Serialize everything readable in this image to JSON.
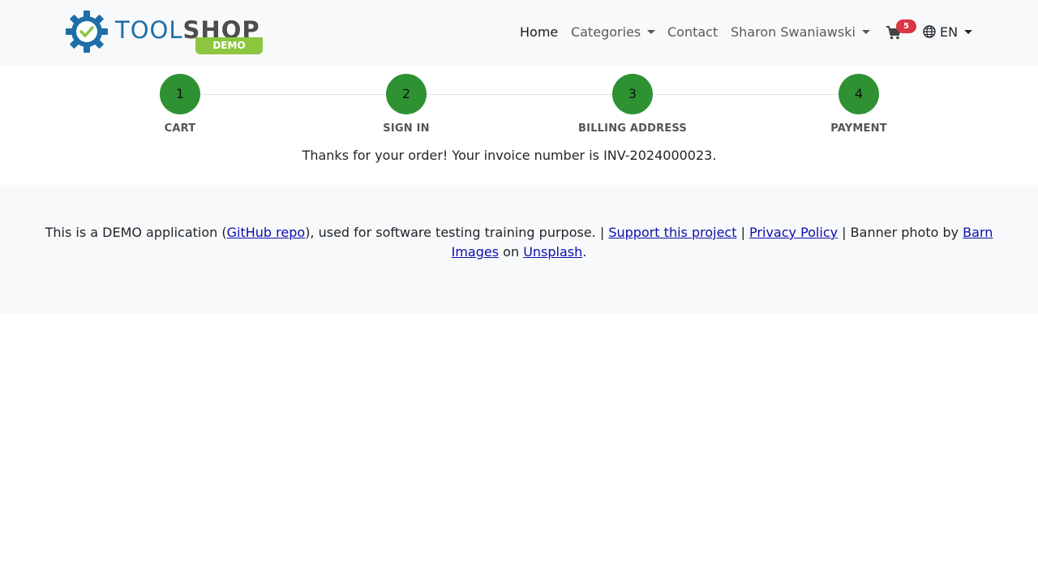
{
  "header": {
    "logo": {
      "text_tool": "TOOL",
      "text_shop": "SHOP",
      "badge": "DEMO",
      "icon": "gear-check-icon"
    },
    "nav": {
      "home": "Home",
      "categories": "Categories",
      "contact": "Contact",
      "user": "Sharon Swaniawski",
      "cart_count": "5",
      "language": "EN"
    }
  },
  "stepper": {
    "steps": [
      {
        "number": "1",
        "label": "CART"
      },
      {
        "number": "2",
        "label": "SIGN IN"
      },
      {
        "number": "3",
        "label": "BILLING ADDRESS"
      },
      {
        "number": "4",
        "label": "PAYMENT"
      }
    ]
  },
  "confirmation": {
    "text_prefix": "Thanks for your order! Your invoice number is ",
    "invoice_number": "INV-2024000023",
    "text_suffix": "."
  },
  "footer": {
    "t1": "This is a DEMO application (",
    "github_link": "GitHub repo",
    "t2": "), used for software testing training purpose. | ",
    "support_link": "Support this project",
    "t3": " | ",
    "privacy_link": "Privacy Policy",
    "t4": " | Banner photo by ",
    "barn_link": "Barn Images",
    "t5": " on ",
    "unsplash_link": "Unsplash",
    "t6": "."
  },
  "colors": {
    "navbar_bg": "#f8f9fa",
    "step_green": "#2e9132",
    "badge_red": "#dc3545",
    "link_blue": "#0d0dac",
    "logo_blue": "#1e6fa8",
    "logo_green": "#8cc63f"
  }
}
